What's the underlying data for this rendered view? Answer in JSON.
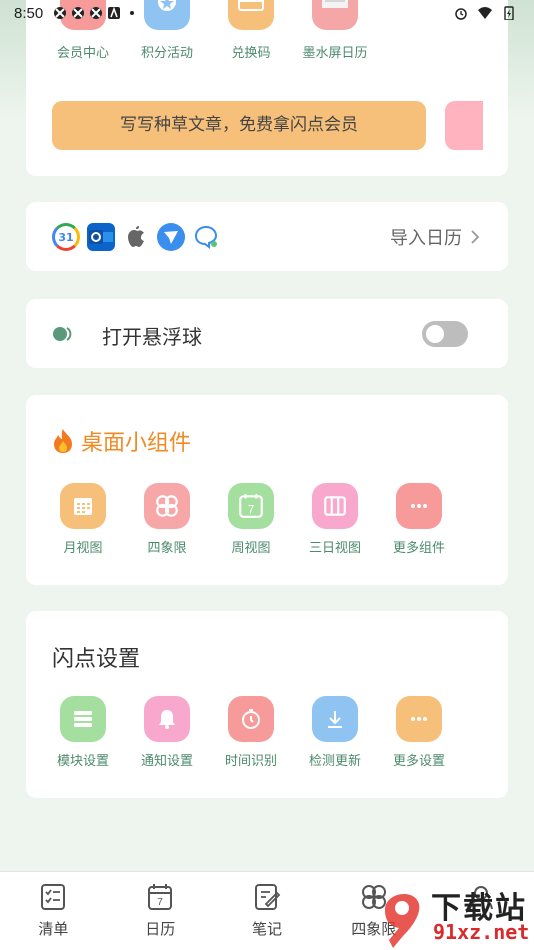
{
  "status_bar": {
    "time": "8:50"
  },
  "quick_actions": [
    {
      "label": "会员中心",
      "color": "#f79a9a",
      "icon": "vip-icon"
    },
    {
      "label": "积分活动",
      "color": "#8fc3f2",
      "icon": "star-badge-icon"
    },
    {
      "label": "兑换码",
      "color": "#f6c07a",
      "icon": "gift-card-icon"
    },
    {
      "label": "墨水屏日历",
      "color": "#f5a6a6",
      "icon": "eink-calendar-icon"
    }
  ],
  "banner": {
    "text": "写写种草文章，免费拿闪点会员",
    "color": "#f6c07a"
  },
  "import_calendar": {
    "label": "导入日历",
    "icons": [
      "google-calendar-icon",
      "outlook-icon",
      "apple-icon",
      "feishu-icon",
      "dingtalk-icon"
    ],
    "google_number": "31"
  },
  "floating_ball": {
    "label": "打开悬浮球",
    "enabled": false
  },
  "widgets": {
    "title": "桌面小组件",
    "items": [
      {
        "label": "月视图",
        "color": "#f6c07a",
        "icon": "month-view-icon"
      },
      {
        "label": "四象限",
        "color": "#f7a7a7",
        "icon": "four-quadrant-icon"
      },
      {
        "label": "周视图",
        "color": "#a5dfa0",
        "icon": "week-view-icon",
        "glyph": "7"
      },
      {
        "label": "三日视图",
        "color": "#f9a8cd",
        "icon": "three-day-view-icon"
      },
      {
        "label": "更多组件",
        "color": "#f79a9a",
        "icon": "more-icon"
      }
    ]
  },
  "settings": {
    "title": "闪点设置",
    "items": [
      {
        "label": "模块设置",
        "color": "#a5dfa0",
        "icon": "module-settings-icon"
      },
      {
        "label": "通知设置",
        "color": "#f9a8cd",
        "icon": "bell-icon"
      },
      {
        "label": "时间识别",
        "color": "#f79a9a",
        "icon": "stopwatch-icon"
      },
      {
        "label": "检测更新",
        "color": "#8fc3f2",
        "icon": "download-icon"
      },
      {
        "label": "更多设置",
        "color": "#f6c07a",
        "icon": "more-icon"
      }
    ]
  },
  "bottom_nav": [
    {
      "label": "清单",
      "icon": "checklist-icon"
    },
    {
      "label": "日历",
      "icon": "calendar-icon",
      "glyph": "7"
    },
    {
      "label": "笔记",
      "icon": "note-icon"
    },
    {
      "label": "四象限",
      "icon": "quadrant-icon"
    },
    {
      "label": "",
      "icon": "profile-icon"
    }
  ],
  "watermark": {
    "text_cn": "下载站",
    "text_en": "91xz.net"
  }
}
